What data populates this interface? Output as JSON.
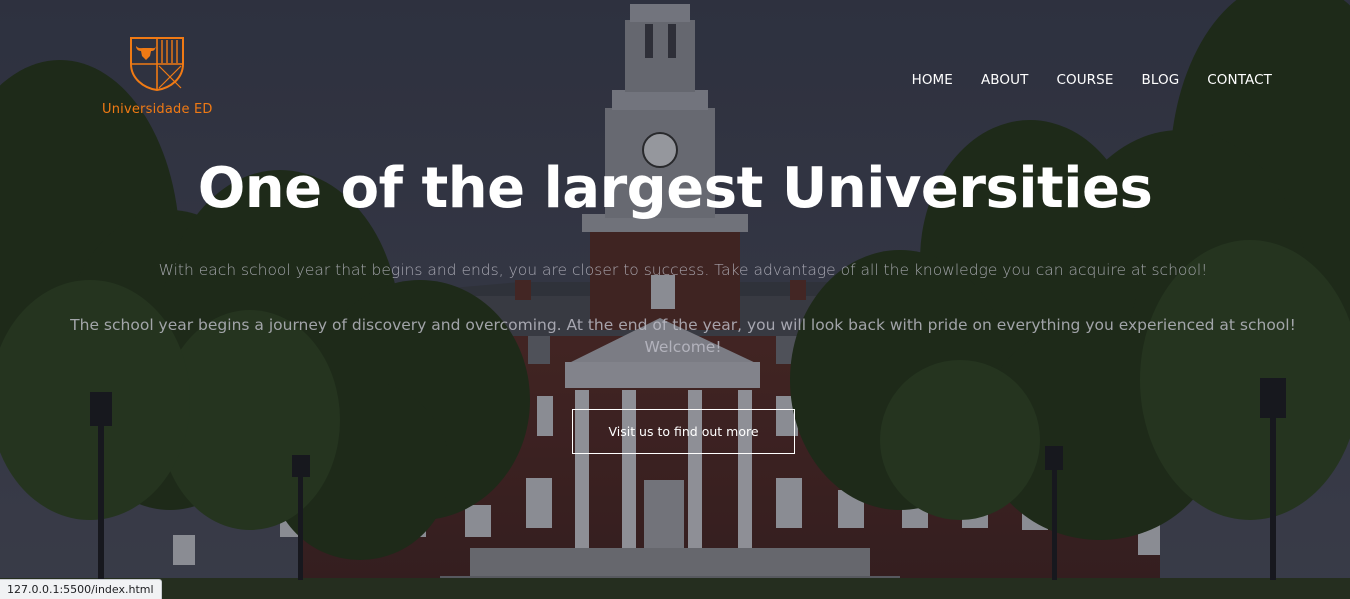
{
  "header": {
    "brand_name": "Universidade ED",
    "brand_color": "#f07a14",
    "logo_icon": "bull-shield-icon",
    "nav": [
      {
        "label": "HOME"
      },
      {
        "label": "ABOUT"
      },
      {
        "label": "COURSE"
      },
      {
        "label": "BLOG"
      },
      {
        "label": "CONTACT"
      }
    ]
  },
  "hero": {
    "title": "One of the largest Universities",
    "line1": "With each school year that begins and ends, you are closer to success. Take advantage of all the knowledge you can acquire at school!",
    "line2": "The school year begins a journey of discovery and overcoming. At the end of the year, you will look back with pride on everything you experienced at school!",
    "line3": "Welcome!",
    "cta_label": "Visit us to find out more"
  },
  "browser": {
    "status_url": "127.0.0.1:5500/index.html"
  }
}
